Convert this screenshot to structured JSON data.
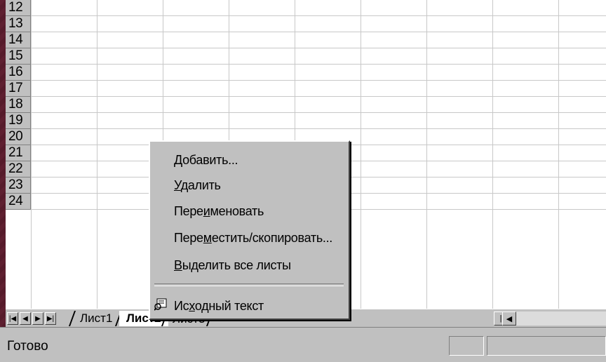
{
  "row_numbers": [
    "12",
    "13",
    "14",
    "15",
    "16",
    "17",
    "18",
    "19",
    "20",
    "21",
    "22",
    "23",
    "24"
  ],
  "sheet_tabs": [
    {
      "label": "Лист1",
      "active": false
    },
    {
      "label": "Лист2",
      "active": true
    },
    {
      "label": "Лист3",
      "active": false
    }
  ],
  "status": {
    "text": "Готово"
  },
  "context_menu": {
    "items": [
      {
        "pre": "",
        "ul": "Д",
        "post": "обавить..."
      },
      {
        "pre": "",
        "ul": "У",
        "post": "далить"
      },
      {
        "pre": "Пере",
        "ul": "и",
        "post": "меновать"
      },
      {
        "pre": "Пере",
        "ul": "м",
        "post": "естить/скопировать..."
      },
      {
        "pre": "",
        "ul": "В",
        "post": "ыделить все листы"
      },
      {
        "pre": "Ис",
        "ul": "х",
        "post": "одный текст"
      }
    ],
    "icons": {
      "source_text": "view-code-icon"
    }
  },
  "colors": {
    "background": "#5a1e2e",
    "window": "#c0c0c0",
    "accent_yellow": "#f5d000"
  }
}
